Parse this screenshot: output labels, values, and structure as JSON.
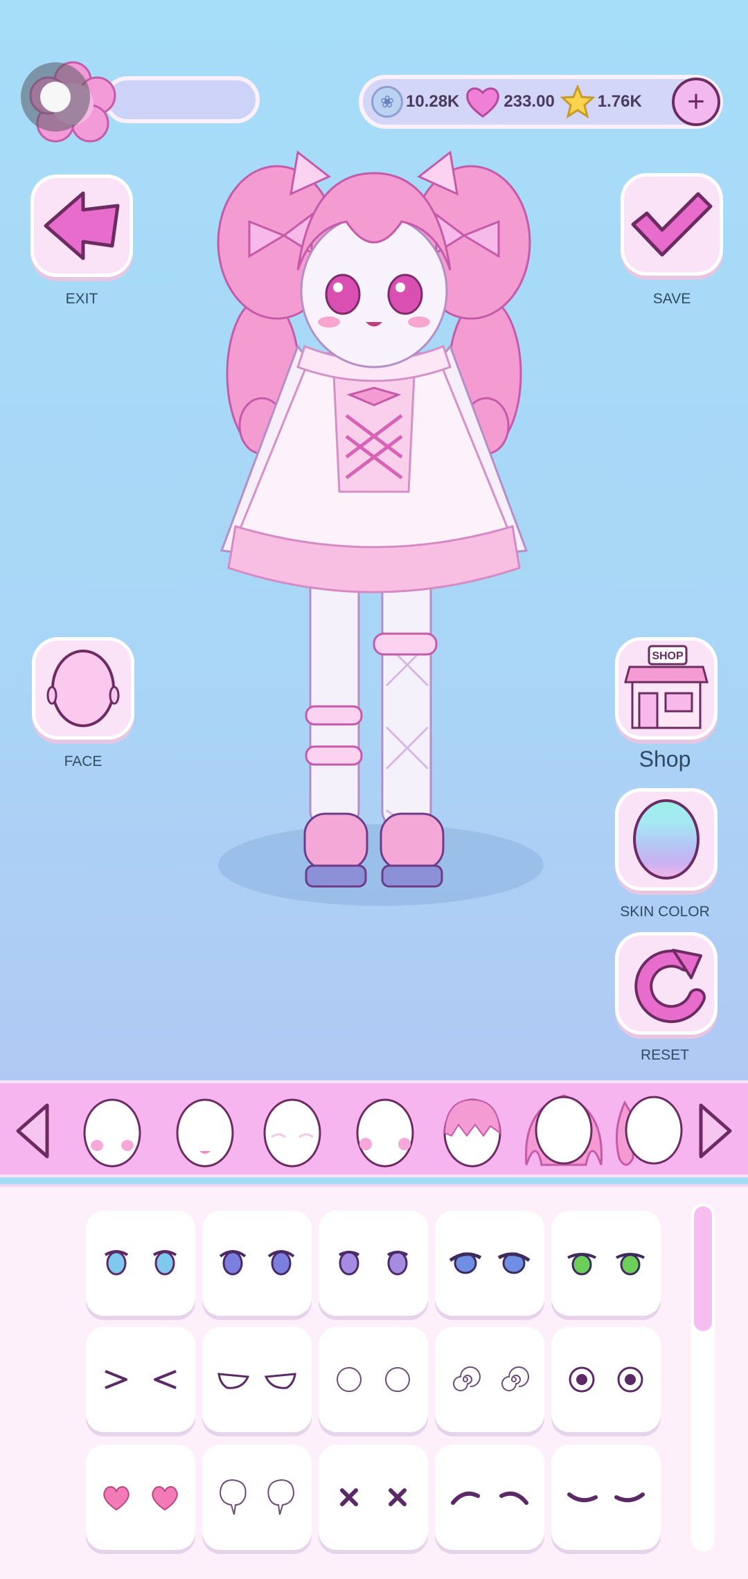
{
  "topbar": {
    "currencies": [
      {
        "icon": "paw-icon",
        "value": "10.28K"
      },
      {
        "icon": "heart-icon",
        "value": "233.00"
      },
      {
        "icon": "star-icon",
        "value": "1.76K"
      }
    ],
    "plus_label": "+"
  },
  "buttons": {
    "exit": "EXIT",
    "save": "SAVE",
    "face": "FACE",
    "shop": "Shop",
    "shop_sign": "SHOP",
    "skin_color": "SKIN COLOR",
    "reset": "RESET"
  },
  "categories": [
    "blush-face",
    "mouth-face",
    "closed-eyes-face",
    "cheek-face",
    "bangs-hair",
    "back-hair",
    "side-hair"
  ],
  "eye_styles": [
    "blue-eyes",
    "indigo-eyes",
    "violet-eyes",
    "sparkle-eyes",
    "green-eyes",
    "squint-eyes",
    "sleepy-eyes",
    "empty-circle-eyes",
    "spiral-eyes",
    "dot-eyes",
    "heart-eyes",
    "tear-eyes",
    "x-eyes",
    "arched-eyes",
    "smile-closed-eyes"
  ],
  "colors": {
    "accent": "#f6b5ee",
    "dark": "#6c2c62",
    "panel": "#fdf0fb"
  }
}
